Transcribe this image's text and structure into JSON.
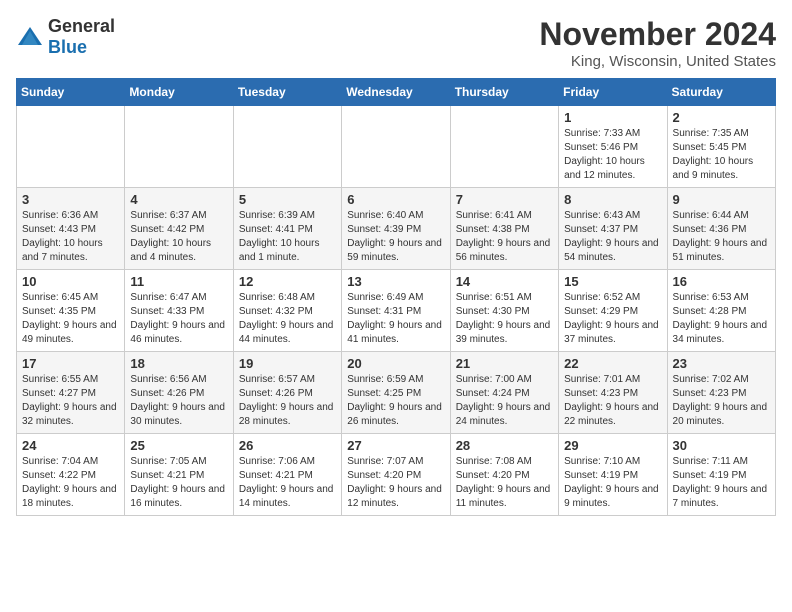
{
  "logo": {
    "general": "General",
    "blue": "Blue"
  },
  "title": "November 2024",
  "subtitle": "King, Wisconsin, United States",
  "weekdays": [
    "Sunday",
    "Monday",
    "Tuesday",
    "Wednesday",
    "Thursday",
    "Friday",
    "Saturday"
  ],
  "weeks": [
    [
      {
        "day": "",
        "info": ""
      },
      {
        "day": "",
        "info": ""
      },
      {
        "day": "",
        "info": ""
      },
      {
        "day": "",
        "info": ""
      },
      {
        "day": "",
        "info": ""
      },
      {
        "day": "1",
        "info": "Sunrise: 7:33 AM\nSunset: 5:46 PM\nDaylight: 10 hours and 12 minutes."
      },
      {
        "day": "2",
        "info": "Sunrise: 7:35 AM\nSunset: 5:45 PM\nDaylight: 10 hours and 9 minutes."
      }
    ],
    [
      {
        "day": "3",
        "info": "Sunrise: 6:36 AM\nSunset: 4:43 PM\nDaylight: 10 hours and 7 minutes."
      },
      {
        "day": "4",
        "info": "Sunrise: 6:37 AM\nSunset: 4:42 PM\nDaylight: 10 hours and 4 minutes."
      },
      {
        "day": "5",
        "info": "Sunrise: 6:39 AM\nSunset: 4:41 PM\nDaylight: 10 hours and 1 minute."
      },
      {
        "day": "6",
        "info": "Sunrise: 6:40 AM\nSunset: 4:39 PM\nDaylight: 9 hours and 59 minutes."
      },
      {
        "day": "7",
        "info": "Sunrise: 6:41 AM\nSunset: 4:38 PM\nDaylight: 9 hours and 56 minutes."
      },
      {
        "day": "8",
        "info": "Sunrise: 6:43 AM\nSunset: 4:37 PM\nDaylight: 9 hours and 54 minutes."
      },
      {
        "day": "9",
        "info": "Sunrise: 6:44 AM\nSunset: 4:36 PM\nDaylight: 9 hours and 51 minutes."
      }
    ],
    [
      {
        "day": "10",
        "info": "Sunrise: 6:45 AM\nSunset: 4:35 PM\nDaylight: 9 hours and 49 minutes."
      },
      {
        "day": "11",
        "info": "Sunrise: 6:47 AM\nSunset: 4:33 PM\nDaylight: 9 hours and 46 minutes."
      },
      {
        "day": "12",
        "info": "Sunrise: 6:48 AM\nSunset: 4:32 PM\nDaylight: 9 hours and 44 minutes."
      },
      {
        "day": "13",
        "info": "Sunrise: 6:49 AM\nSunset: 4:31 PM\nDaylight: 9 hours and 41 minutes."
      },
      {
        "day": "14",
        "info": "Sunrise: 6:51 AM\nSunset: 4:30 PM\nDaylight: 9 hours and 39 minutes."
      },
      {
        "day": "15",
        "info": "Sunrise: 6:52 AM\nSunset: 4:29 PM\nDaylight: 9 hours and 37 minutes."
      },
      {
        "day": "16",
        "info": "Sunrise: 6:53 AM\nSunset: 4:28 PM\nDaylight: 9 hours and 34 minutes."
      }
    ],
    [
      {
        "day": "17",
        "info": "Sunrise: 6:55 AM\nSunset: 4:27 PM\nDaylight: 9 hours and 32 minutes."
      },
      {
        "day": "18",
        "info": "Sunrise: 6:56 AM\nSunset: 4:26 PM\nDaylight: 9 hours and 30 minutes."
      },
      {
        "day": "19",
        "info": "Sunrise: 6:57 AM\nSunset: 4:26 PM\nDaylight: 9 hours and 28 minutes."
      },
      {
        "day": "20",
        "info": "Sunrise: 6:59 AM\nSunset: 4:25 PM\nDaylight: 9 hours and 26 minutes."
      },
      {
        "day": "21",
        "info": "Sunrise: 7:00 AM\nSunset: 4:24 PM\nDaylight: 9 hours and 24 minutes."
      },
      {
        "day": "22",
        "info": "Sunrise: 7:01 AM\nSunset: 4:23 PM\nDaylight: 9 hours and 22 minutes."
      },
      {
        "day": "23",
        "info": "Sunrise: 7:02 AM\nSunset: 4:23 PM\nDaylight: 9 hours and 20 minutes."
      }
    ],
    [
      {
        "day": "24",
        "info": "Sunrise: 7:04 AM\nSunset: 4:22 PM\nDaylight: 9 hours and 18 minutes."
      },
      {
        "day": "25",
        "info": "Sunrise: 7:05 AM\nSunset: 4:21 PM\nDaylight: 9 hours and 16 minutes."
      },
      {
        "day": "26",
        "info": "Sunrise: 7:06 AM\nSunset: 4:21 PM\nDaylight: 9 hours and 14 minutes."
      },
      {
        "day": "27",
        "info": "Sunrise: 7:07 AM\nSunset: 4:20 PM\nDaylight: 9 hours and 12 minutes."
      },
      {
        "day": "28",
        "info": "Sunrise: 7:08 AM\nSunset: 4:20 PM\nDaylight: 9 hours and 11 minutes."
      },
      {
        "day": "29",
        "info": "Sunrise: 7:10 AM\nSunset: 4:19 PM\nDaylight: 9 hours and 9 minutes."
      },
      {
        "day": "30",
        "info": "Sunrise: 7:11 AM\nSunset: 4:19 PM\nDaylight: 9 hours and 7 minutes."
      }
    ]
  ]
}
